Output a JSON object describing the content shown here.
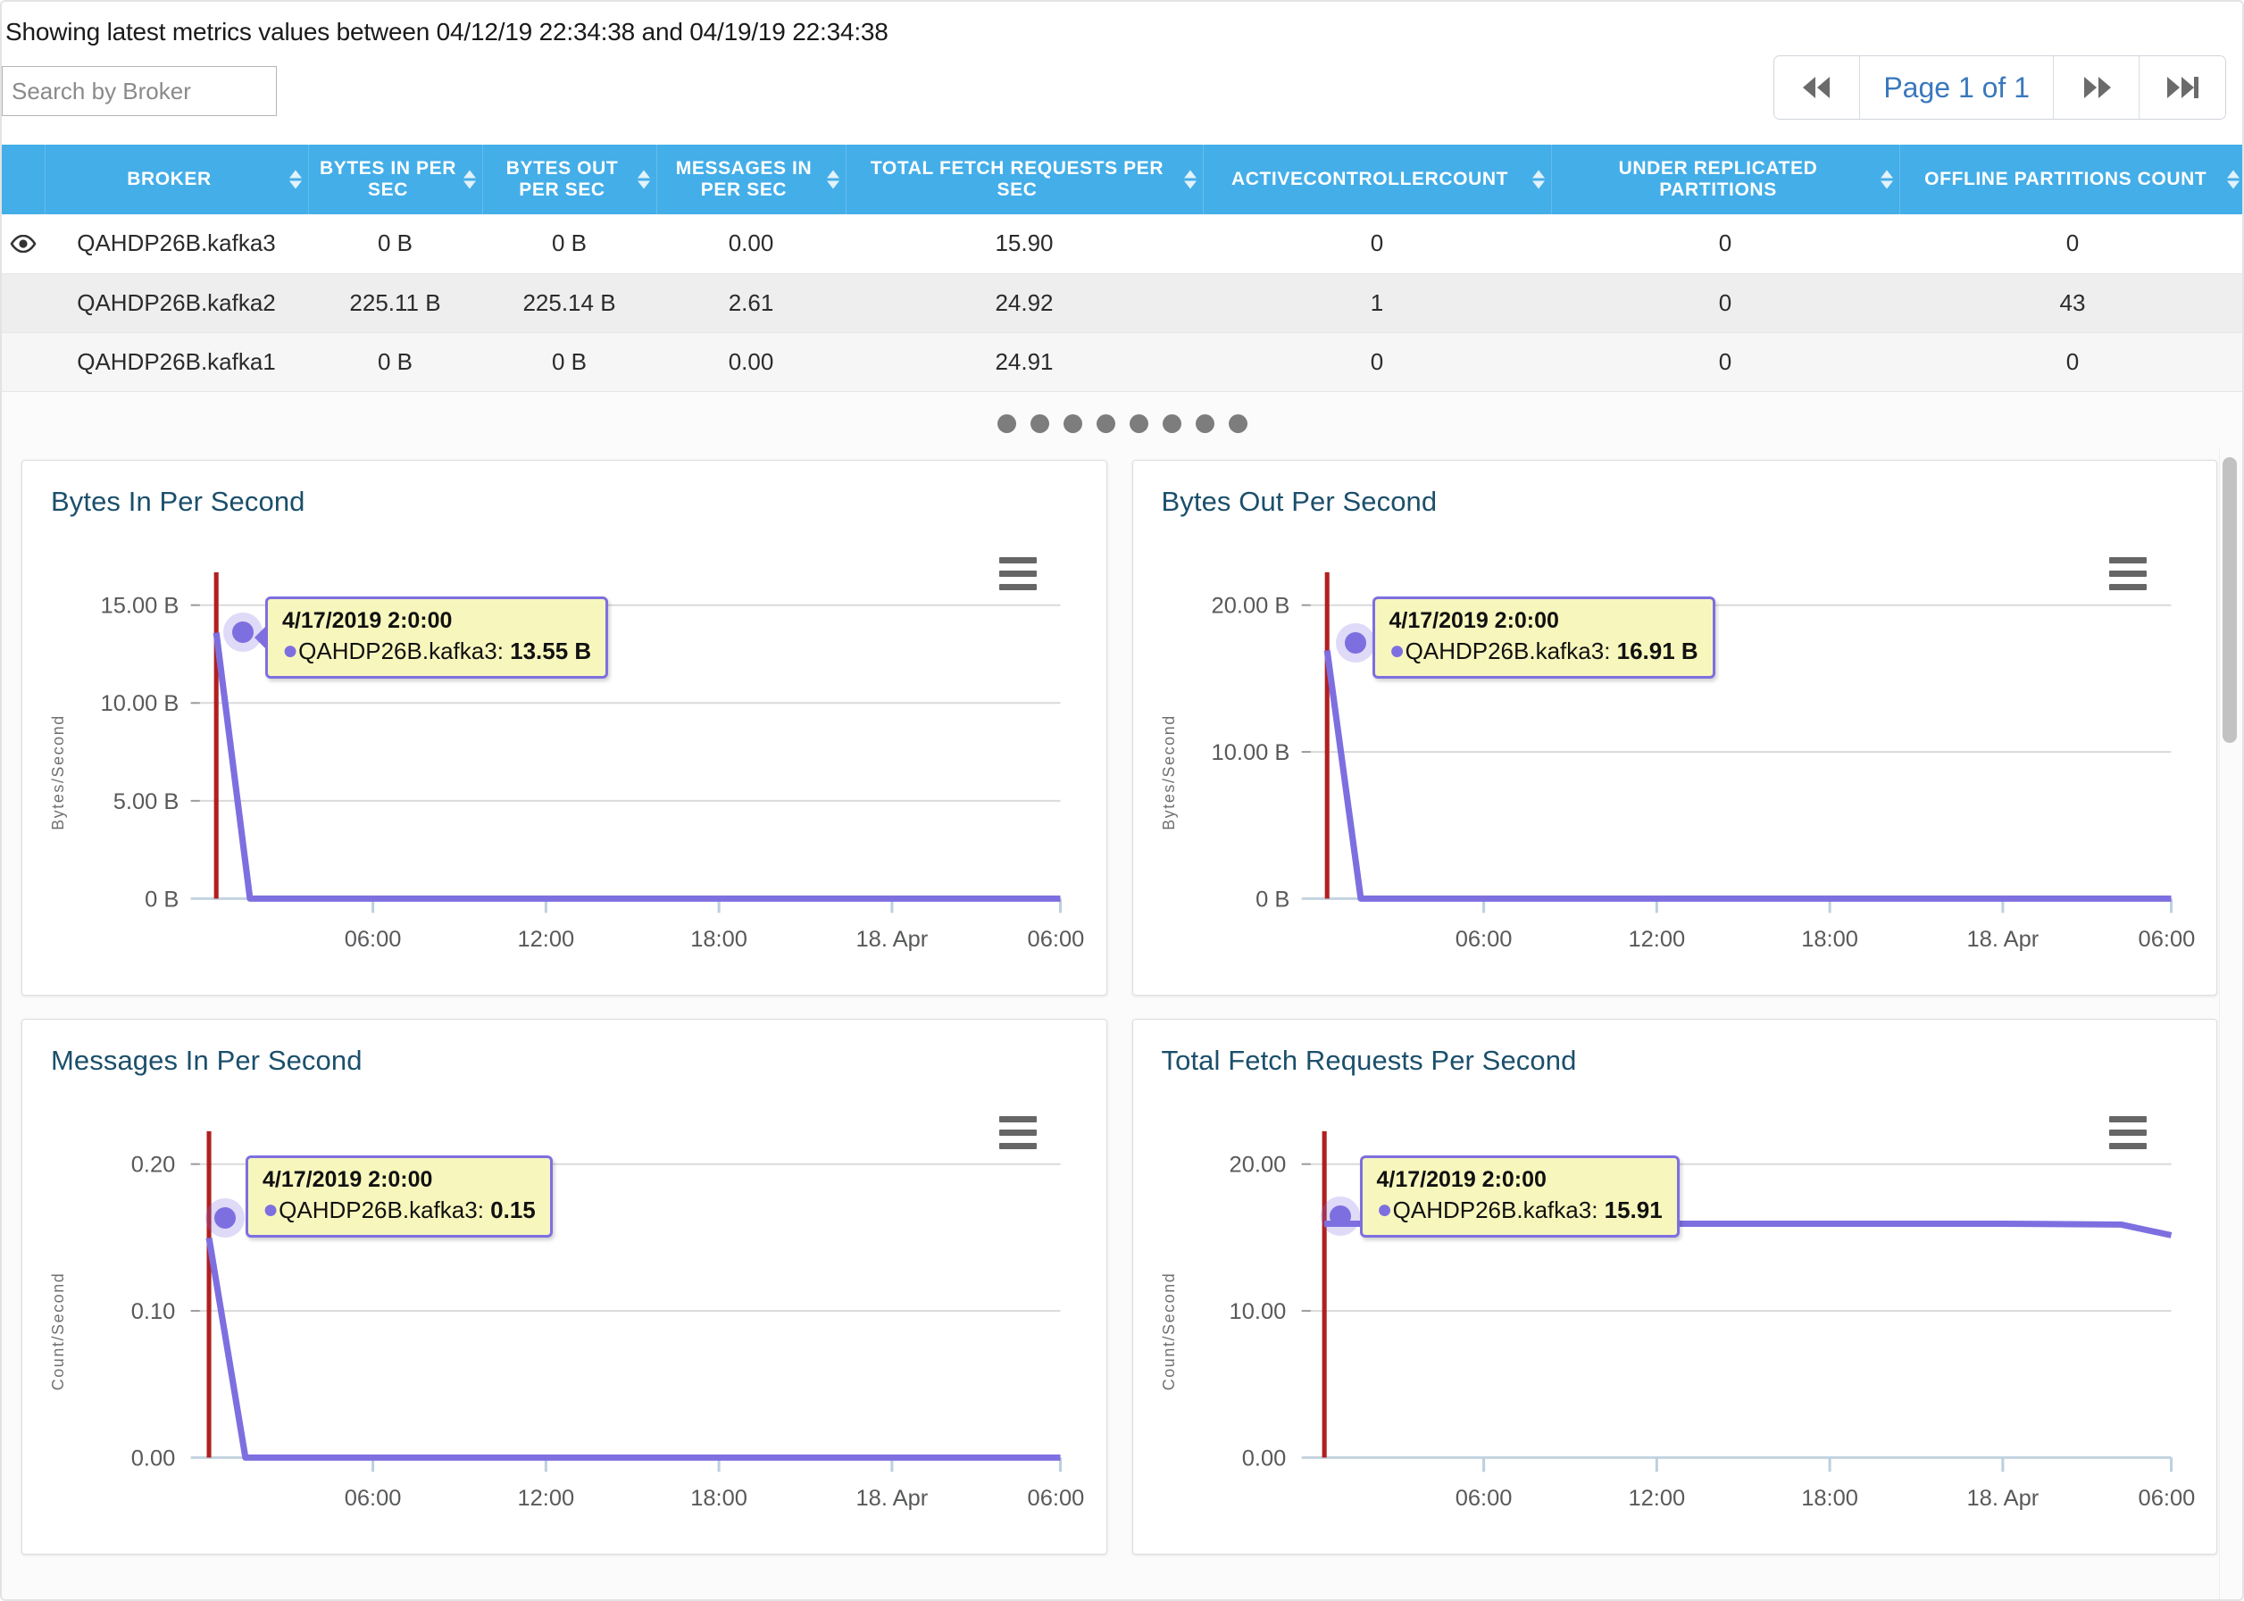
{
  "header": {
    "range_text": "Showing latest metrics values between 04/12/19 22:34:38 and 04/19/19 22:34:38",
    "search_placeholder": "Search by Broker",
    "search_value": ""
  },
  "pagination": {
    "prev_label": "◀◀",
    "page_label": "Page 1 of 1",
    "next_label": "▶▶",
    "last_label": "▶▶|",
    "accent_color": "#3a78bd"
  },
  "carousel": {
    "dot_count": 8,
    "active_index": 0,
    "dot_color": "#7d7d7d"
  },
  "table": {
    "header_color": "#44aee8",
    "columns": [
      "",
      "BROKER",
      "BYTES IN PER SEC",
      "BYTES OUT PER SEC",
      "MESSAGES IN PER SEC",
      "TOTAL FETCH REQUESTS PER SEC",
      "ACTIVECONTROLLERCOUNT",
      "UNDER REPLICATED PARTITIONS",
      "OFFLINE PARTITIONS COUNT"
    ],
    "rows": [
      {
        "eye": true,
        "broker": "QAHDP26B.kafka3",
        "bytes_in_per_sec": "0 B",
        "bytes_out_per_sec": "0 B",
        "messages_in_per_sec": "0.00",
        "total_fetch_requests_per_sec": "15.90",
        "activecontrollercount": "0",
        "under_replicated_partitions": "0",
        "offline_partitions_count": "0"
      },
      {
        "eye": false,
        "broker": "QAHDP26B.kafka2",
        "bytes_in_per_sec": "225.11 B",
        "bytes_out_per_sec": "225.14 B",
        "messages_in_per_sec": "2.61",
        "total_fetch_requests_per_sec": "24.92",
        "activecontrollercount": "1",
        "under_replicated_partitions": "0",
        "offline_partitions_count": "43"
      },
      {
        "eye": false,
        "broker": "QAHDP26B.kafka1",
        "bytes_in_per_sec": "0 B",
        "bytes_out_per_sec": "0 B",
        "messages_in_per_sec": "0.00",
        "total_fetch_requests_per_sec": "24.91",
        "activecontrollercount": "0",
        "under_replicated_partitions": "0",
        "offline_partitions_count": "0"
      }
    ]
  },
  "chart_data": [
    {
      "type": "line",
      "title": "Bytes In Per Second",
      "ylabel": "Bytes/Second",
      "xlabel": "",
      "series_name": "QAHDP26B.kafka3",
      "yticks": [
        "15.00 B",
        "10.00 B",
        "5.00 B",
        "0 B"
      ],
      "ytick_values": [
        15,
        10,
        5,
        0
      ],
      "ylim": [
        0,
        16.5
      ],
      "xticks": [
        "06:00",
        "12:00",
        "18:00",
        "18. Apr",
        "06:00"
      ],
      "grid": true,
      "legend": "none",
      "line_color": "#7e6fe0",
      "plotline_color": "#b02020",
      "x": [
        "4/17/2019 2:00",
        "4/17/2019 4:00",
        "4/17/2019 06:00",
        "4/17/2019 12:00",
        "4/17/2019 18:00",
        "4/18/2019 00:00",
        "4/18/2019 06:00"
      ],
      "values": [
        13.55,
        0,
        0,
        0,
        0,
        0,
        0
      ],
      "tooltip": {
        "date": "4/17/2019 2:0:00",
        "series": "QAHDP26B.kafka3",
        "value": "13.55 B"
      },
      "highlight_point": {
        "x": "4/17/2019 2:0:00",
        "y": 13.55
      }
    },
    {
      "type": "line",
      "title": "Bytes Out Per Second",
      "ylabel": "Bytes/Second",
      "xlabel": "",
      "series_name": "QAHDP26B.kafka3",
      "yticks": [
        "20.00 B",
        "10.00 B",
        "0 B"
      ],
      "ytick_values": [
        20,
        10,
        0
      ],
      "ylim": [
        0,
        22
      ],
      "xticks": [
        "06:00",
        "12:00",
        "18:00",
        "18. Apr",
        "06:00"
      ],
      "grid": true,
      "legend": "none",
      "line_color": "#7e6fe0",
      "plotline_color": "#b02020",
      "x": [
        "4/17/2019 2:00",
        "4/17/2019 4:00",
        "4/17/2019 06:00",
        "4/17/2019 12:00",
        "4/17/2019 18:00",
        "4/18/2019 00:00",
        "4/18/2019 06:00"
      ],
      "values": [
        16.91,
        0,
        0,
        0,
        0,
        0,
        0
      ],
      "tooltip": {
        "date": "4/17/2019 2:0:00",
        "series": "QAHDP26B.kafka3",
        "value": "16.91 B"
      },
      "highlight_point": {
        "x": "4/17/2019 2:0:00",
        "y": 16.91
      }
    },
    {
      "type": "line",
      "title": "Messages In Per Second",
      "ylabel": "Count/Second",
      "xlabel": "",
      "series_name": "QAHDP26B.kafka3",
      "yticks": [
        "0.20",
        "0.10",
        "0.00"
      ],
      "ytick_values": [
        0.2,
        0.1,
        0
      ],
      "ylim": [
        0,
        0.22
      ],
      "xticks": [
        "06:00",
        "12:00",
        "18:00",
        "18. Apr",
        "06:00"
      ],
      "grid": true,
      "legend": "none",
      "line_color": "#7e6fe0",
      "plotline_color": "#b02020",
      "x": [
        "4/17/2019 2:00",
        "4/17/2019 4:00",
        "4/17/2019 06:00",
        "4/17/2019 12:00",
        "4/17/2019 18:00",
        "4/18/2019 00:00",
        "4/18/2019 06:00"
      ],
      "values": [
        0.15,
        0,
        0,
        0,
        0,
        0,
        0
      ],
      "tooltip": {
        "date": "4/17/2019 2:0:00",
        "series": "QAHDP26B.kafka3",
        "value": "0.15"
      },
      "highlight_point": {
        "x": "4/17/2019 2:0:00",
        "y": 0.15
      }
    },
    {
      "type": "line",
      "title": "Total Fetch Requests Per Second",
      "ylabel": "Count/Second",
      "xlabel": "",
      "series_name": "QAHDP26B.kafka3",
      "yticks": [
        "20.00",
        "10.00",
        "0.00"
      ],
      "ytick_values": [
        20,
        10,
        0
      ],
      "ylim": [
        0,
        22
      ],
      "xticks": [
        "06:00",
        "12:00",
        "18:00",
        "18. Apr",
        "06:00"
      ],
      "grid": true,
      "legend": "none",
      "line_color": "#7e6fe0",
      "plotline_color": "#b02020",
      "x": [
        "4/17/2019 2:00",
        "4/17/2019 06:00",
        "4/17/2019 12:00",
        "4/17/2019 18:00",
        "4/18/2019 00:00",
        "4/18/2019 04:00",
        "4/18/2019 06:00"
      ],
      "values": [
        15.91,
        15.91,
        15.91,
        15.91,
        15.91,
        15.9,
        15.5
      ],
      "tooltip": {
        "date": "4/17/2019 2:0:00",
        "series": "QAHDP26B.kafka3",
        "value": "15.91"
      },
      "highlight_point": {
        "x": "4/17/2019 2:0:00",
        "y": 15.91
      }
    }
  ],
  "icons": {
    "eye": "eye-icon",
    "hamburger": "hamburger-menu-icon",
    "sort": "sort-arrows-icon"
  }
}
